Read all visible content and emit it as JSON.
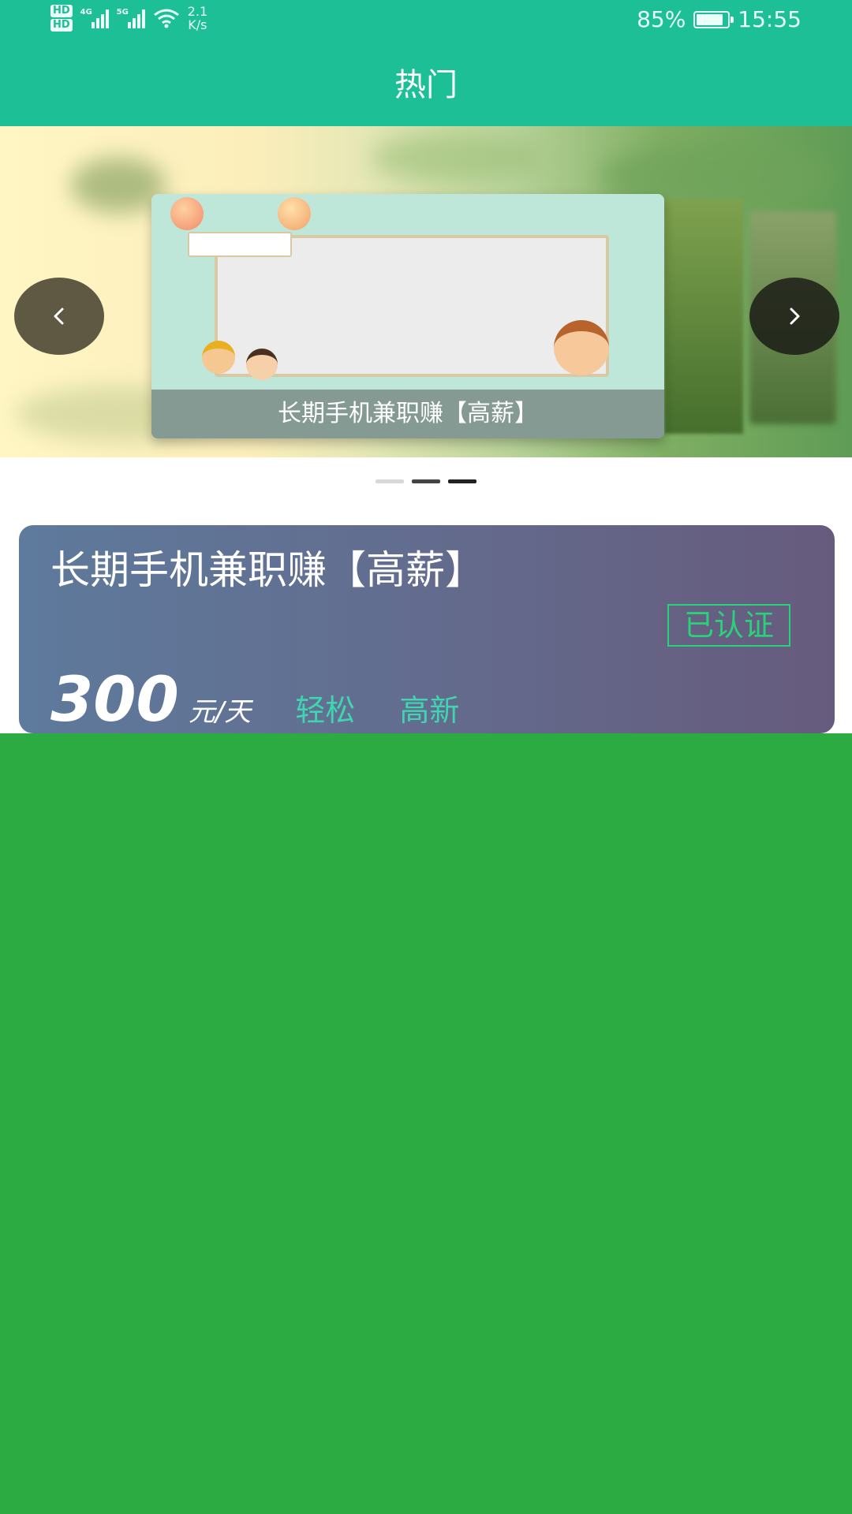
{
  "status_bar": {
    "hd_badges": [
      "HD",
      "HD"
    ],
    "network_gen_1": "4G",
    "network_gen_2": "5G",
    "net_speed_value": "2.1",
    "net_speed_unit": "K/s",
    "battery_percent": "85%",
    "battery_level": 0.85,
    "time": "15:55"
  },
  "header": {
    "title": "热门"
  },
  "banner": {
    "slide_caption": "长期手机兼职赚【高薪】",
    "prev_icon": "chevron-left-icon",
    "next_icon": "chevron-right-icon",
    "slide_count": 3,
    "active_index": 2
  },
  "job_card": {
    "title": "长期手机兼职赚【高薪】",
    "verified_label": "已认证",
    "salary": "300",
    "salary_unit": "元/天",
    "tags": [
      "轻松",
      "高新"
    ]
  },
  "colors": {
    "header_bg": "#1cbf96",
    "verified": "#2bd07c",
    "tag_text": "#3fd5b0",
    "filler_green": "#2dab43"
  }
}
